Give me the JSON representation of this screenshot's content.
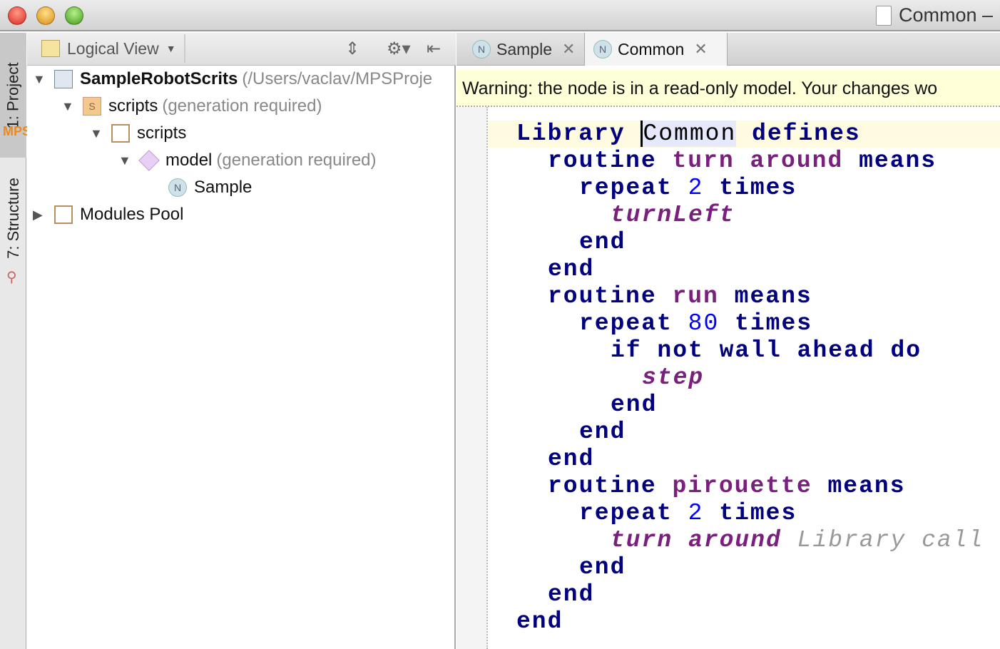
{
  "window": {
    "title": "Common –"
  },
  "sidebar": {
    "tab_project": "1: Project",
    "tab_structure": "7: Structure"
  },
  "project_toolbar": {
    "view_label": "Logical View"
  },
  "tree": [
    {
      "label": "SampleRobotScrits",
      "note": "(/Users/vaclav/MPSProje",
      "icon": "project-icon",
      "expanded": "open"
    },
    {
      "label": "scripts",
      "note": "(generation required)",
      "icon": "solution-icon",
      "expanded": "open"
    },
    {
      "label": "scripts",
      "note": "",
      "icon": "folder-icon",
      "expanded": "open"
    },
    {
      "label": "model",
      "note": "(generation required)",
      "icon": "model-icon",
      "expanded": "open"
    },
    {
      "label": "Sample",
      "note": "",
      "icon": "node-icon",
      "expanded": "none"
    },
    {
      "label": "Modules Pool",
      "note": "",
      "icon": "modules-pool-icon",
      "expanded": "closed"
    }
  ],
  "editor_tabs": [
    {
      "label": "Sample",
      "active": false
    },
    {
      "label": "Common",
      "active": true
    }
  ],
  "warning": "Warning: the node is in a read-only model. Your changes wo",
  "code": [
    {
      "indent": 0,
      "tokens": [
        [
          "kw",
          "Library"
        ],
        [
          "sp",
          " "
        ],
        [
          "id",
          "Common"
        ],
        [
          "sp",
          " "
        ],
        [
          "kw",
          "defines"
        ]
      ]
    },
    {
      "indent": 1,
      "tokens": [
        [
          "kw",
          "routine"
        ],
        [
          "sp",
          " "
        ],
        [
          "nm",
          "turn around"
        ],
        [
          "sp",
          " "
        ],
        [
          "kw",
          "means"
        ]
      ]
    },
    {
      "indent": 2,
      "tokens": [
        [
          "kw",
          "repeat"
        ],
        [
          "sp",
          " "
        ],
        [
          "num",
          "2"
        ],
        [
          "sp",
          " "
        ],
        [
          "kw",
          "times"
        ]
      ]
    },
    {
      "indent": 3,
      "tokens": [
        [
          "call",
          "turnLeft"
        ]
      ]
    },
    {
      "indent": 2,
      "tokens": [
        [
          "kw",
          "end"
        ]
      ]
    },
    {
      "indent": 1,
      "tokens": [
        [
          "kw",
          "end"
        ]
      ]
    },
    {
      "indent": 1,
      "tokens": [
        [
          "kw",
          "routine"
        ],
        [
          "sp",
          " "
        ],
        [
          "nm",
          "run"
        ],
        [
          "sp",
          " "
        ],
        [
          "kw",
          "means"
        ]
      ]
    },
    {
      "indent": 2,
      "tokens": [
        [
          "kw",
          "repeat"
        ],
        [
          "sp",
          " "
        ],
        [
          "num",
          "80"
        ],
        [
          "sp",
          " "
        ],
        [
          "kw",
          "times"
        ]
      ]
    },
    {
      "indent": 3,
      "tokens": [
        [
          "kw",
          "if not wall ahead do"
        ]
      ]
    },
    {
      "indent": 4,
      "tokens": [
        [
          "call",
          "step"
        ]
      ]
    },
    {
      "indent": 3,
      "tokens": [
        [
          "kw",
          "end"
        ]
      ]
    },
    {
      "indent": 2,
      "tokens": [
        [
          "kw",
          "end"
        ]
      ]
    },
    {
      "indent": 1,
      "tokens": [
        [
          "kw",
          "end"
        ]
      ]
    },
    {
      "indent": 1,
      "tokens": [
        [
          "kw",
          "routine"
        ],
        [
          "sp",
          " "
        ],
        [
          "nm",
          "pirouette"
        ],
        [
          "sp",
          " "
        ],
        [
          "kw",
          "means"
        ]
      ]
    },
    {
      "indent": 2,
      "tokens": [
        [
          "kw",
          "repeat"
        ],
        [
          "sp",
          " "
        ],
        [
          "num",
          "2"
        ],
        [
          "sp",
          " "
        ],
        [
          "kw",
          "times"
        ]
      ]
    },
    {
      "indent": 3,
      "tokens": [
        [
          "call",
          "turn around"
        ],
        [
          "sp",
          " "
        ],
        [
          "hint",
          "Library call"
        ]
      ]
    },
    {
      "indent": 2,
      "tokens": [
        [
          "kw",
          "end"
        ]
      ]
    },
    {
      "indent": 1,
      "tokens": [
        [
          "kw",
          "end"
        ]
      ]
    },
    {
      "indent": 0,
      "tokens": [
        [
          "kw",
          "end"
        ]
      ]
    }
  ]
}
